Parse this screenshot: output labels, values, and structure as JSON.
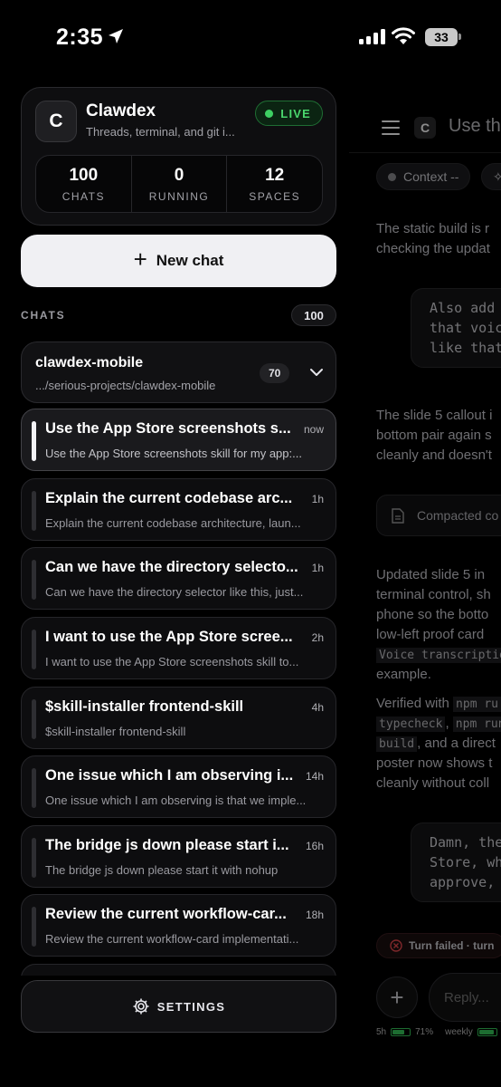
{
  "status_bar": {
    "time": "2:35",
    "battery": "33"
  },
  "background_chat": {
    "title": "Use the",
    "context_pill": "Context --",
    "paragraph1": "The static build is r\nchecking the updat",
    "code1": "Also add\nthat voic\nlike that",
    "paragraph2": "The slide 5 callout i\nbottom pair again s\ncleanly and doesn't",
    "compacted": "Compacted co",
    "paragraph3": "Updated slide 5 in \nterminal control, sh\nphone so the botto\nlow-left proof card",
    "mono1": "Voice transcriptio",
    "paragraph3_end": "example.",
    "verified_prefix": "Verified with ",
    "mono_npm_ru": "npm ru",
    "mono_typecheck": "typecheck",
    "mono_npm_run": "npm run",
    "mono_build": "build",
    "verified_mid": ", and a direct",
    "paragraph4": "poster now shows t\ncleanly without coll",
    "code2": "Damn, the\nStore, wh\napprove,",
    "turn_failed": "Turn failed · turn",
    "reply_placeholder": "Reply...",
    "usage_5h": "5h",
    "usage_pct": "71%",
    "usage_weekly": "weekly"
  },
  "app": {
    "logo_letter": "C",
    "name": "Clawdex",
    "subtitle": "Threads, terminal, and git i...",
    "live": "LIVE"
  },
  "stats": [
    {
      "value": "100",
      "label": "CHATS"
    },
    {
      "value": "0",
      "label": "RUNNING"
    },
    {
      "value": "12",
      "label": "SPACES"
    }
  ],
  "new_chat_label": "New chat",
  "chats_section": {
    "label": "CHATS",
    "count": "100"
  },
  "project": {
    "name": "clawdex-mobile",
    "path": ".../serious-projects/clawdex-mobile",
    "count": "70"
  },
  "chats": [
    {
      "title": "Use the App Store screenshots s...",
      "time": "now",
      "preview": "Use the App Store screenshots skill for my app:...",
      "active": true
    },
    {
      "title": "Explain the current codebase arc...",
      "time": "1h",
      "preview": "Explain the current codebase architecture, laun..."
    },
    {
      "title": "Can we have the directory selecto...",
      "time": "1h",
      "preview": "Can we have the directory selector like this, just..."
    },
    {
      "title": "I want to use the App Store scree...",
      "time": "2h",
      "preview": "I want to use the App Store screenshots skill to..."
    },
    {
      "title": "$skill-installer frontend-skill",
      "time": "4h",
      "preview": "$skill-installer frontend-skill"
    },
    {
      "title": "One issue which I am observing i...",
      "time": "14h",
      "preview": "One issue which I am observing is that we imple..."
    },
    {
      "title": "The bridge js down please start i...",
      "time": "16h",
      "preview": "The bridge js down please start it with nohup"
    },
    {
      "title": "Review the current workflow-car...",
      "time": "18h",
      "preview": "Review the current workflow-card implementati..."
    },
    {
      "title": "",
      "time": "",
      "preview": ""
    }
  ],
  "settings_label": "SETTINGS"
}
